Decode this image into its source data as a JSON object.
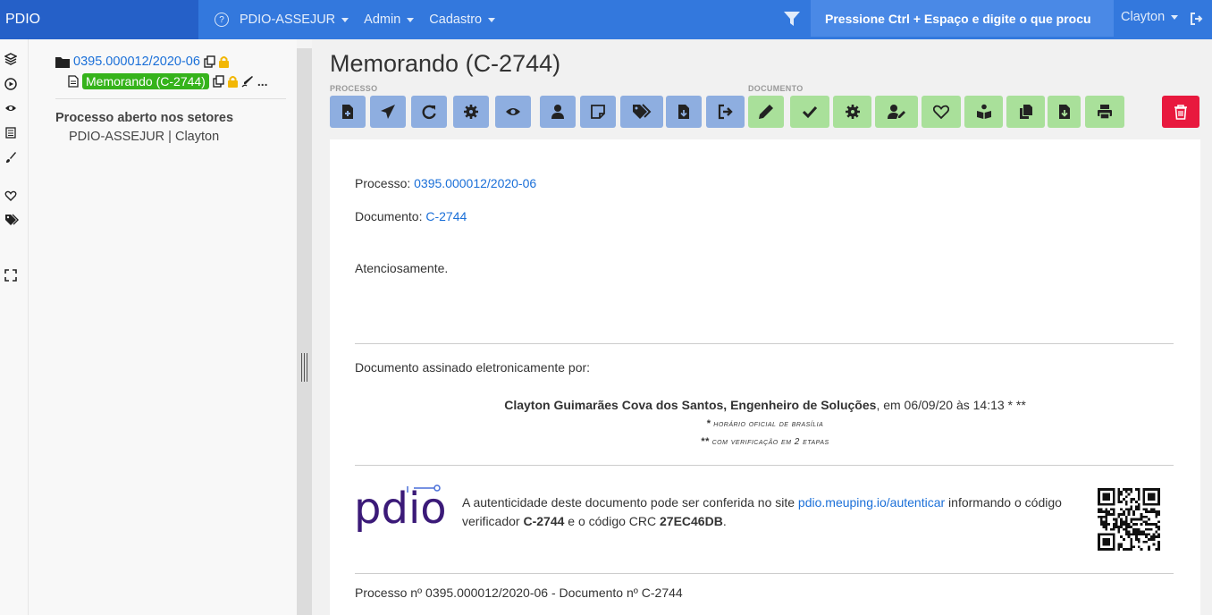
{
  "navbar": {
    "brand": "PDIO",
    "help_icon": "question-circle-icon",
    "items": [
      {
        "label": "PDIO-ASSEJUR"
      },
      {
        "label": "Admin"
      },
      {
        "label": "Cadastro"
      }
    ],
    "filter_icon": "filter-icon",
    "search_hint": "Pressione Ctrl + Espaço e digite o que procu",
    "user": "Clayton",
    "logout_icon": "logout-icon"
  },
  "sidebar_icons": [
    "layers-icon",
    "play-circle-icon",
    "eye-icon",
    "calendar-icon",
    "brush-icon",
    "heart-icon",
    "tags-icon",
    "expand-icon"
  ],
  "tree": {
    "process_number": "0395.000012/2020-06",
    "document_label": "Memorando (C-2744)",
    "more": "...",
    "heading": "Processo aberto nos setores",
    "sector": "PDIO-ASSEJUR | Clayton"
  },
  "main": {
    "title": "Memorando (C-2744)",
    "toolbar": {
      "process_label": "PROCESSO",
      "document_label": "DOCUMENTO"
    }
  },
  "document": {
    "processo_label": "Processo:",
    "processo_value": "0395.000012/2020-06",
    "documento_label": "Documento:",
    "documento_value": "C-2744",
    "closing": "Atenciosamente.",
    "signed_by_label": "Documento assinado eletronicamente por:",
    "signer_name": "Clayton Guimarães Cova dos Santos, Engenheiro de Soluções",
    "signer_date": ", em 06/09/20 às 14:13 * **",
    "note1_mark": "*",
    "note1": "horário oficial de brasília",
    "note2_mark": "**",
    "note2": "com verificação em 2 etapas",
    "auth_text_1": "A autenticidade deste documento pode ser conferida no site ",
    "auth_link": "pdio.meuping.io/autenticar",
    "auth_text_2": " informando o código verificador ",
    "auth_code": "C-2744",
    "auth_text_3": " e o código CRC ",
    "auth_crc": "27EC46DB",
    "auth_text_4": ".",
    "footer": "Processo nº 0395.000012/2020-06 - Documento nº C-2744"
  },
  "colors": {
    "navbar": "#3378dd",
    "brand": "#2560c8",
    "link": "#1a6fd8",
    "green_badge": "#35b31b",
    "process_button": "#8eaee0",
    "document_button": "#a9e09a",
    "delete_button": "#e8193e",
    "logo": "#3b1a78"
  }
}
